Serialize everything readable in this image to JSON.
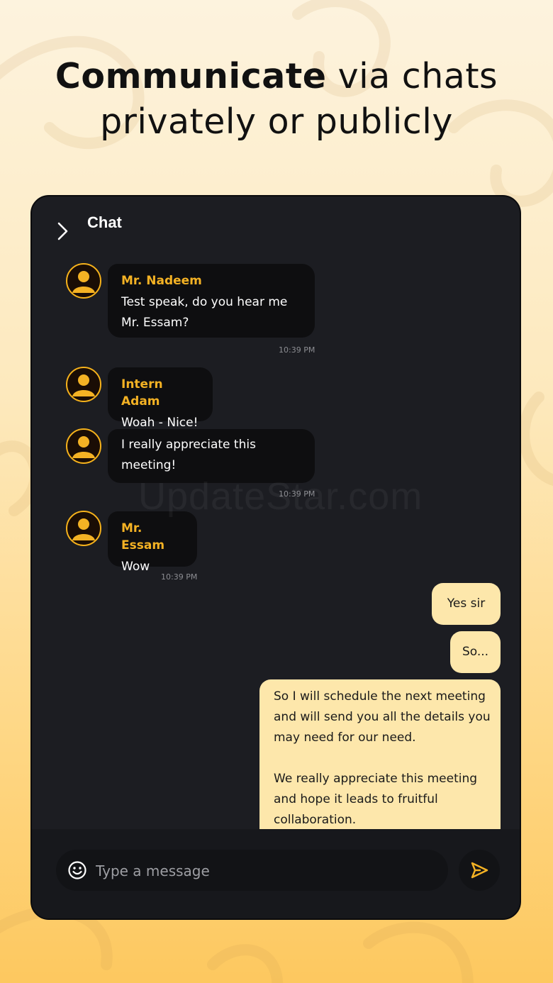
{
  "headline": {
    "bold": "Communicate",
    "rest_line1": " via chats",
    "line2": "privately or publicly"
  },
  "chat": {
    "title": "Chat",
    "messages": [
      {
        "sender": "Mr. Nadeem",
        "lines": [
          "Test speak, do you hear me",
          "Mr. Essam?"
        ],
        "time": "10:39 PM"
      },
      {
        "sender": "Intern Adam",
        "lines": [
          "Woah - Nice!"
        ]
      },
      {
        "lines": [
          "I really appreciate this",
          "meeting!"
        ],
        "time": "10:39 PM"
      },
      {
        "sender": "Mr. Essam",
        "lines": [
          "Wow"
        ],
        "time": "10:39 PM"
      }
    ],
    "outgoing": [
      {
        "text": "Yes sir"
      },
      {
        "text": "So..."
      },
      {
        "lines": [
          "So I will schedule the next meeting",
          "and will send you all the details you",
          "may need for our need.",
          "",
          "We really appreciate this meeting",
          "and hope it leads to fruitful",
          "collaboration."
        ]
      }
    ]
  },
  "composer": {
    "placeholder": "Type a message"
  },
  "watermark": "UpdateStar.com",
  "colors": {
    "accent": "#f4b224",
    "outgoing_bubble": "#fde7ab",
    "panel": "#1c1d22"
  },
  "icons": {
    "back": "chevron-right-icon",
    "emoji": "smiley-icon",
    "send": "send-icon",
    "avatar": "user-icon"
  }
}
